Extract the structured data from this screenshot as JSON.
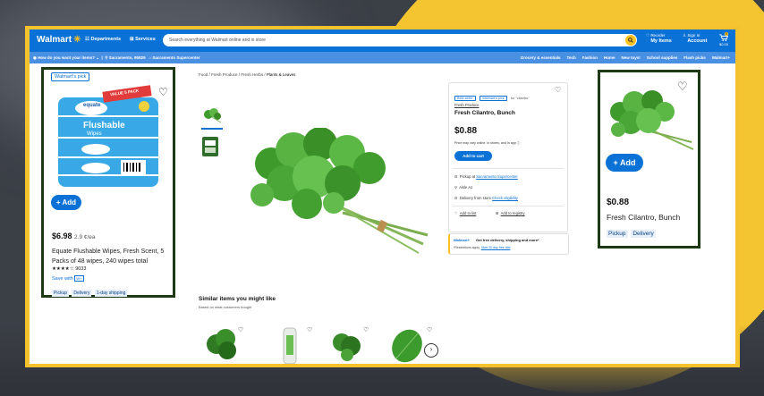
{
  "header": {
    "logo": "Walmart",
    "departments": "Departments",
    "services": "Services",
    "search_placeholder": "Search everything at Walmart online and in store",
    "reorder_top": "Reorder",
    "reorder_main": "My Items",
    "signin_top": "Sign In",
    "signin_main": "Account",
    "cart_count": "0",
    "cart_total": "$0.00"
  },
  "subheader": {
    "delivery": "How do you want your items?",
    "location": "Sacramento, 95829",
    "store": "Sacramento Supercenter",
    "categories": [
      "Grocery & essentials",
      "Tech",
      "Fashion",
      "Home",
      "New toys!",
      "School supplies",
      "Flash picks",
      "Walmart+"
    ]
  },
  "breadcrumb": [
    "Food",
    "Fresh Produce",
    "Fresh Herbs",
    "Plants & Leaves"
  ],
  "left_card": {
    "badge": "Walmart's pick",
    "pack_label_top": "VALUE 5 PACK",
    "pack_brand": "equate",
    "pack_name": "Flushable",
    "pack_sub": "Wipes",
    "add_label": "+ Add",
    "price": "$6.98",
    "unit_price": "2.9 ¢/ea",
    "name": "Equate Flushable Wipes, Fresh Scent, 5 Packs of 48 wipes, 240 wipes total",
    "rating_stars": 4.5,
    "review_count": "9033",
    "save_with": "Save with",
    "save_brand": "W+",
    "tags": [
      "Pickup",
      "Delivery",
      "1-day shipping"
    ]
  },
  "product": {
    "chips": [
      "Best seller",
      "Walmart's pick"
    ],
    "chip_for": "for \"cilantro\"",
    "brand_link": "Fresh Produce",
    "name": "Fresh Cilantro, Bunch",
    "price": "$0.88",
    "price_note": "Price may vary online, in stores, and in app",
    "add_to_cart": "Add to cart",
    "pickup_prefix": "Pickup at",
    "pickup_store": "Sacramento Supercenter",
    "aisle": "Aisle A1",
    "delivery_prefix": "Delivery from store",
    "delivery_link": "Check eligibility",
    "add_to_list": "Add to list",
    "add_to_registry": "Add to registry"
  },
  "banner": {
    "brand": "Walmart+",
    "text": "Get free delivery, shipping and more*",
    "note": "*Restrictions apply.",
    "link": "Start 30-day free trial"
  },
  "right_card": {
    "add_label": "+ Add",
    "price": "$0.88",
    "name": "Fresh Cilantro, Bunch",
    "tags": [
      "Pickup",
      "Delivery"
    ]
  },
  "similar": {
    "title": "Similar items you might like",
    "subtitle": "Based on what customers bought"
  },
  "colors": {
    "walmart_blue": "#0a71d6",
    "spark_yellow": "#ffc220",
    "frame_yellow": "#f4c22c",
    "card_border": "#1d3a14"
  }
}
